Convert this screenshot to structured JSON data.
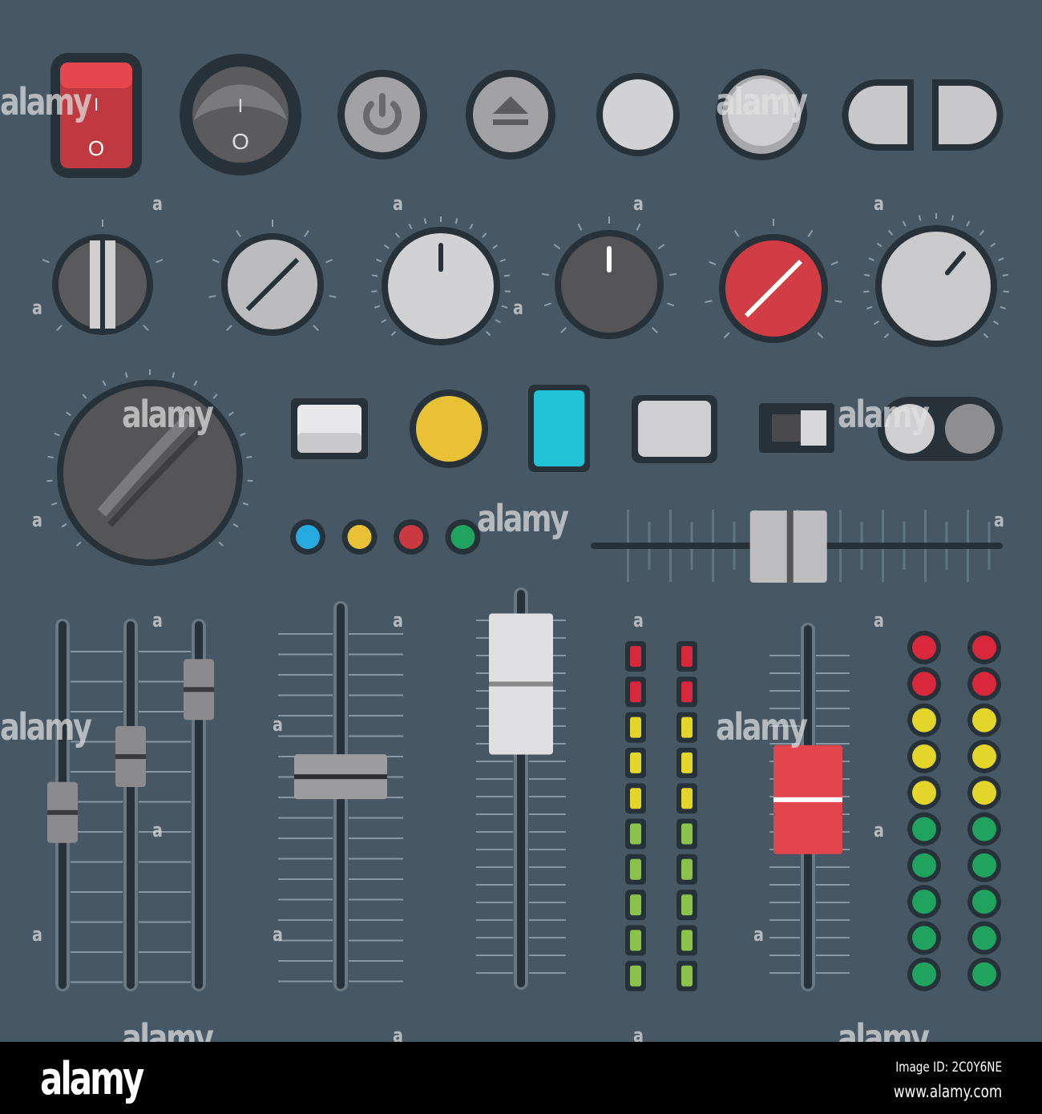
{
  "colors": {
    "background": "#475764",
    "outline": "#263139",
    "red": "#c9393f",
    "yellow": "#e8c234",
    "cyan": "#22c3d6",
    "green": "#20a35f",
    "blue": "#28a9e0",
    "led_red": "#d9283c",
    "led_yellow": "#e3d52a",
    "led_green": "#1fa35f"
  },
  "switches": {
    "rocker_on_label": "I",
    "rocker_off_label": "O",
    "round_on_label": "I",
    "round_off_label": "O"
  },
  "icons": {
    "power": "power-icon",
    "eject": "eject-icon"
  },
  "indicator_leds": [
    "blue",
    "yellow",
    "red",
    "green"
  ],
  "faders": {
    "horizontal_slider_value": 0.48,
    "mini_faders_values": [
      0.48,
      0.63,
      0.81
    ],
    "wide_fader_value": 0.55,
    "white_fader_value": 0.76,
    "red_fader_value": 0.52
  },
  "level_meters": {
    "segments": [
      "red",
      "red",
      "yellow",
      "yellow",
      "yellow",
      "green",
      "green",
      "green",
      "green",
      "green"
    ],
    "lit_count": 10
  },
  "led_columns": {
    "segments": [
      "red",
      "red",
      "yellow",
      "yellow",
      "yellow",
      "green",
      "green",
      "green",
      "green",
      "green"
    ]
  },
  "watermark": {
    "text": "alamy",
    "mark": "a"
  },
  "footer": {
    "logo": "alamy",
    "image_id": "Image ID: 2C0Y6NE",
    "url": "www.alamy.com"
  }
}
